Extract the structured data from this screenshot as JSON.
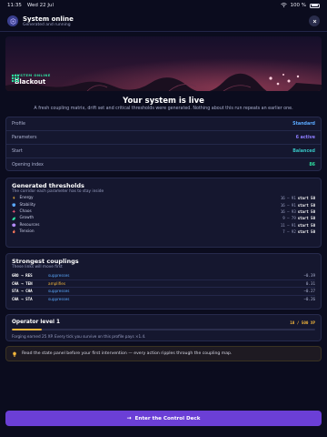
{
  "status_bar": {
    "time": "11:35",
    "date": "Wed 22 Jul",
    "battery": "100 %"
  },
  "header": {
    "title": "System online",
    "subtitle": "Generated and running"
  },
  "hero": {
    "kicker": "SYSTEM ONLINE",
    "name": "Blackout"
  },
  "live": {
    "title": "Your system is live",
    "description": "A fresh coupling matrix, drift set and critical thresholds were generated. Nothing about this run repeats an earlier one."
  },
  "summary": [
    {
      "label": "Profile",
      "value": "Standard",
      "color": "#5aa9ff"
    },
    {
      "label": "Parameters",
      "value": "6 active",
      "color": "#8e7dff"
    },
    {
      "label": "Start",
      "value": "Balanced",
      "color": "#37c2c2"
    },
    {
      "label": "Opening index",
      "value": "86",
      "color": "#2ee0a0"
    }
  ],
  "thresholds": {
    "title": "Generated thresholds",
    "subtitle": "The corridor each parameter has to stay inside",
    "rows": [
      {
        "name": "Energy",
        "range": "16 – 91",
        "start": "start 50",
        "icon": "bolt-icon",
        "color": "#f5b73b"
      },
      {
        "name": "Stability",
        "range": "16 – 91",
        "start": "start 50",
        "icon": "shield-icon",
        "color": "#5aa9ff"
      },
      {
        "name": "Chaos",
        "range": "16 – 93",
        "start": "start 50",
        "icon": "spark-icon",
        "color": "#ff5c7a"
      },
      {
        "name": "Growth",
        "range": "9 – 79",
        "start": "start 50",
        "icon": "leaf-icon",
        "color": "#2ee0a0"
      },
      {
        "name": "Resources",
        "range": "11 – 91",
        "start": "start 50",
        "icon": "cube-icon",
        "color": "#b58cff"
      },
      {
        "name": "Tension",
        "range": "7 – 92",
        "start": "start 50",
        "icon": "flame-icon",
        "color": "#ff7a5c"
      }
    ]
  },
  "couplings": {
    "title": "Strongest couplings",
    "subtitle": "These links will move first",
    "rows": [
      {
        "pair": "GRO → RES",
        "effect": "suppresses",
        "value": "−0.39",
        "color": "#5aa9ff"
      },
      {
        "pair": "CHA → TEN",
        "effect": "amplifies",
        "value": "0.31",
        "color": "#f5b73b"
      },
      {
        "pair": "STA → CHA",
        "effect": "suppresses",
        "value": "−0.27",
        "color": "#5aa9ff"
      },
      {
        "pair": "CHA → STA",
        "effect": "suppresses",
        "value": "−0.26",
        "color": "#5aa9ff"
      }
    ]
  },
  "operator": {
    "title": "Operator level 1",
    "xp": "10 / 500 XP",
    "progress": 0.1,
    "note": "Forging earned 25 XP. Every tick you survive on this profile pays ×1.4."
  },
  "tip": {
    "text": "Read the state panel before your first intervention — every action ripples through the coupling map."
  },
  "cta": {
    "label": "Enter the Control Deck"
  }
}
